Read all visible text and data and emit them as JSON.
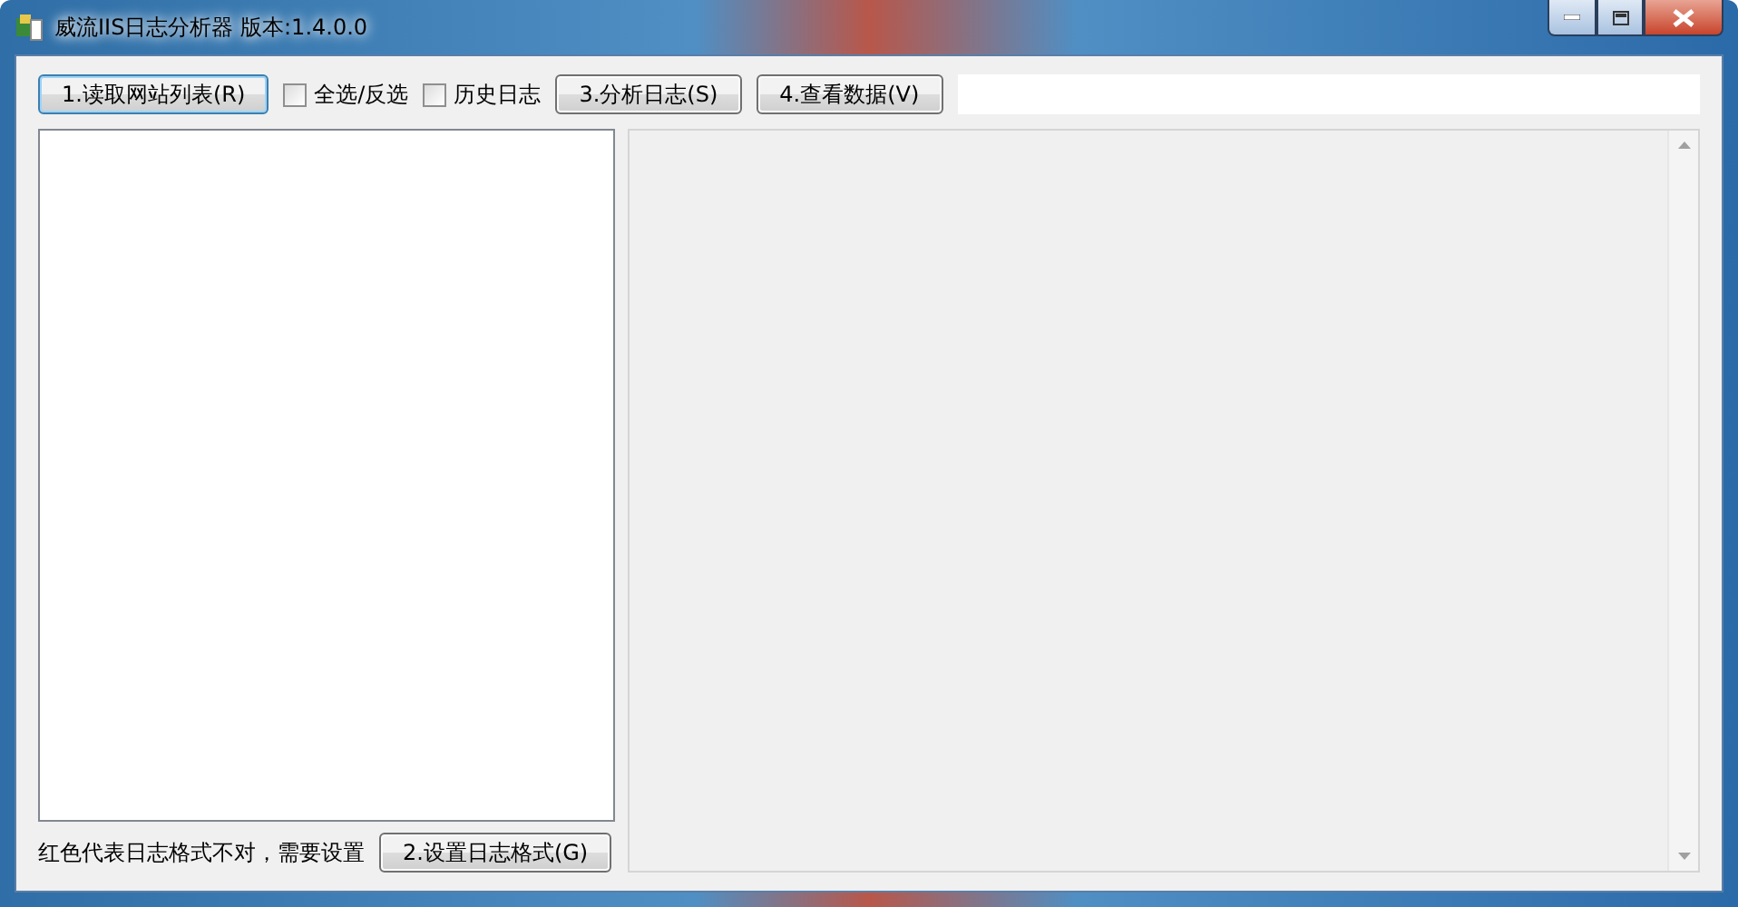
{
  "window": {
    "title": "威流IIS日志分析器 版本:1.4.0.0"
  },
  "toolbar": {
    "items": [
      {
        "kind": "button",
        "label": "1.读取网站列表(R)",
        "focused": true
      },
      {
        "kind": "checkbox",
        "label": "全选/反选",
        "checked": false
      },
      {
        "kind": "checkbox",
        "label": "历史日志",
        "checked": false
      },
      {
        "kind": "button",
        "label": "3.分析日志(S)",
        "focused": false
      },
      {
        "kind": "button",
        "label": "4.查看数据(V)",
        "focused": false
      }
    ]
  },
  "bottom": {
    "note": "红色代表日志格式不对，需要设置",
    "button": "2.设置日志格式(G)"
  }
}
